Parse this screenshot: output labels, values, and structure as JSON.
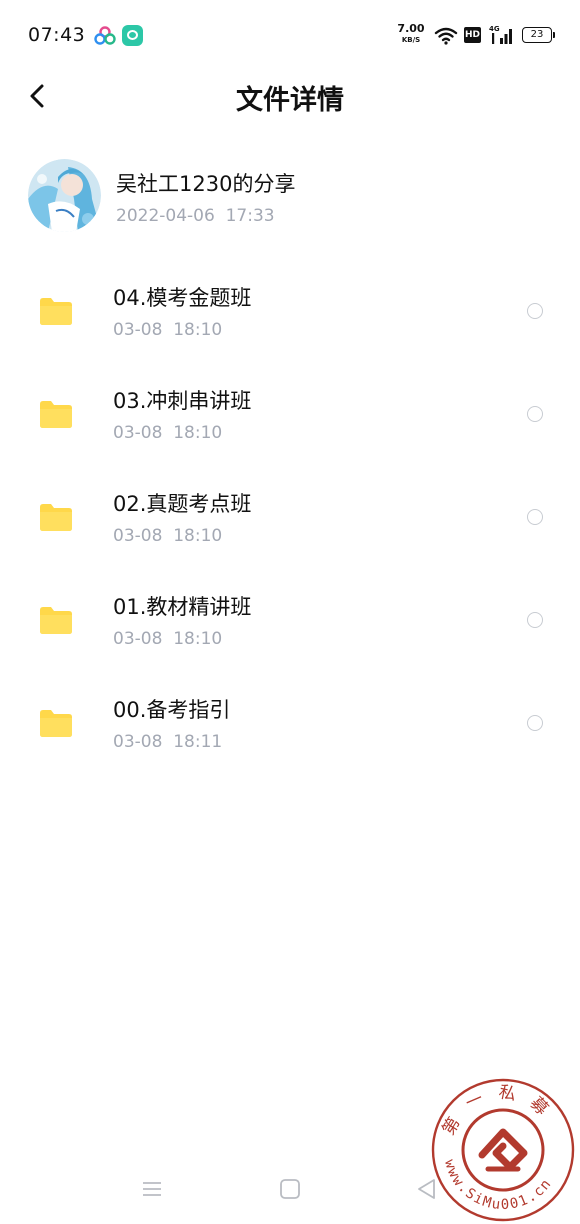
{
  "status_bar": {
    "time": "07:43",
    "net_speed_value": "7.00",
    "net_speed_unit": "KB/S",
    "hd_label": "HD",
    "network_type": "4G",
    "battery_level": "23",
    "icons": [
      "app-notification-icon",
      "app-chat-icon",
      "wifi-icon",
      "hd-icon",
      "signal-icon",
      "battery-icon"
    ]
  },
  "header": {
    "title": "文件详情",
    "back_icon": "chevron-left-icon"
  },
  "share": {
    "sharer": "吴社工1230的分享",
    "date": "2022-04-06  17:33"
  },
  "files": [
    {
      "name": "04.模考金题班",
      "time": "03-08  18:10"
    },
    {
      "name": "03.冲刺串讲班",
      "time": "03-08  18:10"
    },
    {
      "name": "02.真题考点班",
      "time": "03-08  18:10"
    },
    {
      "name": "01.教材精讲班",
      "time": "03-08  18:10"
    },
    {
      "name": "00.备考指引",
      "time": "03-08  18:11"
    }
  ],
  "nav_bar": {
    "icons": [
      "menu-icon",
      "home-icon",
      "back-triangle-icon"
    ]
  },
  "watermark": {
    "top_text": "第一私募",
    "bottom_text": "www.SiMu001.cn"
  },
  "colors": {
    "folder": "#ffd84a",
    "secondary_text": "#a3a8b3",
    "primary_text": "#111111",
    "watermark_red": "#b23a2e"
  }
}
